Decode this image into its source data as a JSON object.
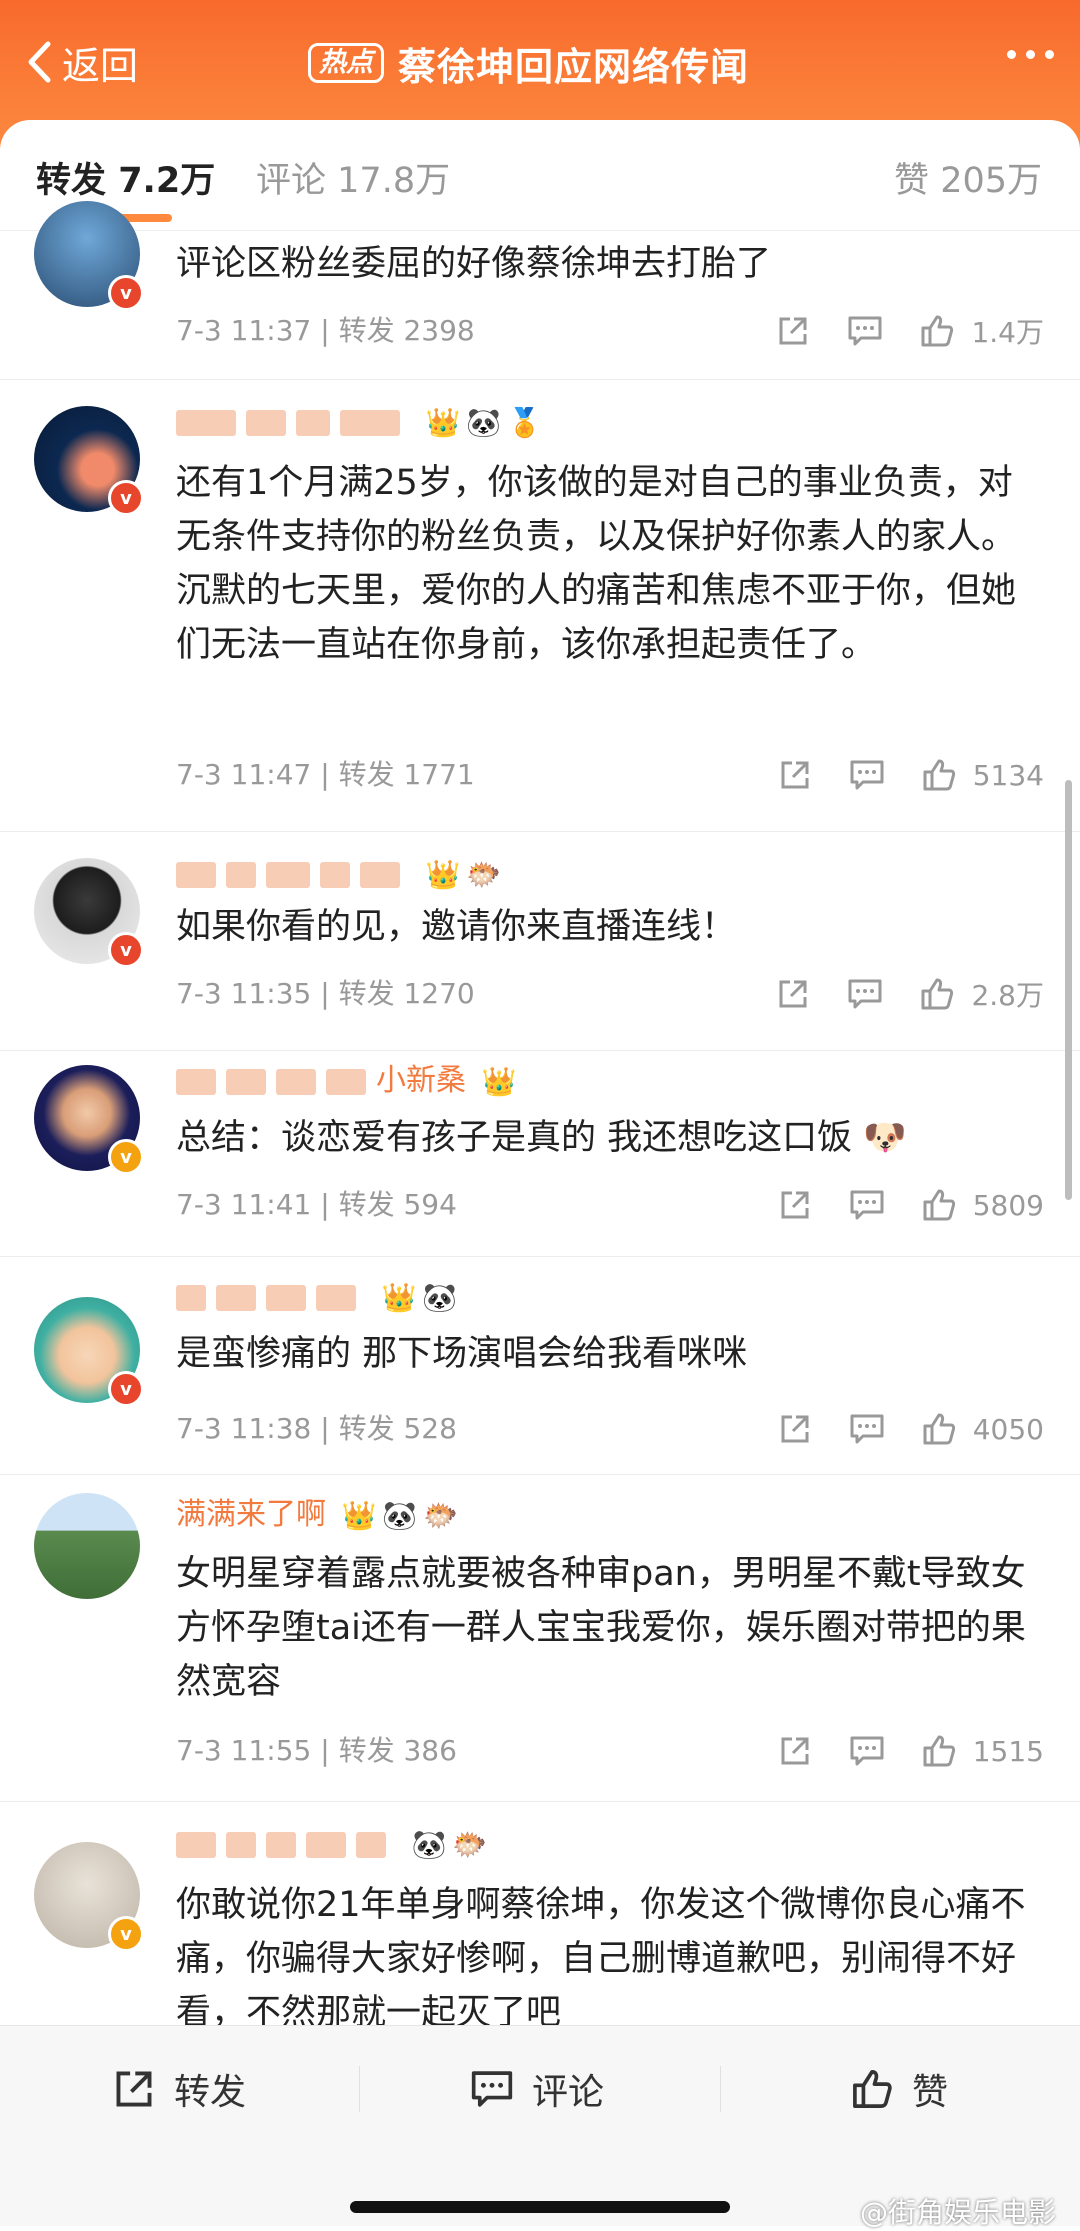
{
  "header": {
    "back_label": "返回",
    "hot_badge": "热点",
    "title": "蔡徐坤回应网络传闻"
  },
  "tabs": {
    "repost_label": "转发",
    "repost_count": "7.2万",
    "comment_label": "评论",
    "comment_count": "17.8万",
    "likes_label": "赞",
    "likes_count": "205万"
  },
  "items": [
    {
      "name": "",
      "text": "评论区粉丝委屈的好像蔡徐坤去打胎了",
      "time": "7-3 11:37",
      "repost_label": "转发",
      "repost_count": "2398",
      "likes": "1.4万"
    },
    {
      "name": "",
      "text": "还有1个月满25岁，你该做的是对自己的事业负责，对无条件支持你的粉丝负责，以及保护好你素人的家人。沉默的七天里，爱你的人的痛苦和焦虑不亚于你，但她们无法一直站在你身前，该你承担起责任了。",
      "time": "7-3 11:47",
      "repost_label": "转发",
      "repost_count": "1771",
      "likes": "5134"
    },
    {
      "name": "",
      "text": "如果你看的见，邀请你来直播连线！",
      "time": "7-3 11:35",
      "repost_label": "转发",
      "repost_count": "1270",
      "likes": "2.8万"
    },
    {
      "name": "小新桑",
      "text": "总结：谈恋爱有孩子是真的 我还想吃这口饭",
      "time": "7-3 11:41",
      "repost_label": "转发",
      "repost_count": "594",
      "likes": "5809"
    },
    {
      "name": "",
      "text": "是蛮惨痛的 那下场演唱会给我看咪咪",
      "time": "7-3 11:38",
      "repost_label": "转发",
      "repost_count": "528",
      "likes": "4050"
    },
    {
      "name": "满满来了啊",
      "text": "女明星穿着露点就要被各种审pan，男明星不戴t导致女方怀孕堕tai还有一群人宝宝我爱你，娱乐圈对带把的果然宽容",
      "time": "7-3 11:55",
      "repost_label": "转发",
      "repost_count": "386",
      "likes": "1515"
    },
    {
      "name": "",
      "text": "你敢说你21年单身啊蔡徐坤，你发这个微博你良心痛不痛，你骗得大家好惨啊，自己删博道歉吧，别闹得不好看，不然那就一起灭了吧",
      "time": "",
      "repost_label": "",
      "repost_count": "",
      "likes": ""
    }
  ],
  "bottom_bar": {
    "repost": "转发",
    "comment": "评论",
    "like": "赞"
  },
  "watermark": "@街角娱乐电影",
  "colors": {
    "header_orange": "#f86a2c",
    "accent": "#ff8a3d",
    "username": "#f37a3e"
  }
}
